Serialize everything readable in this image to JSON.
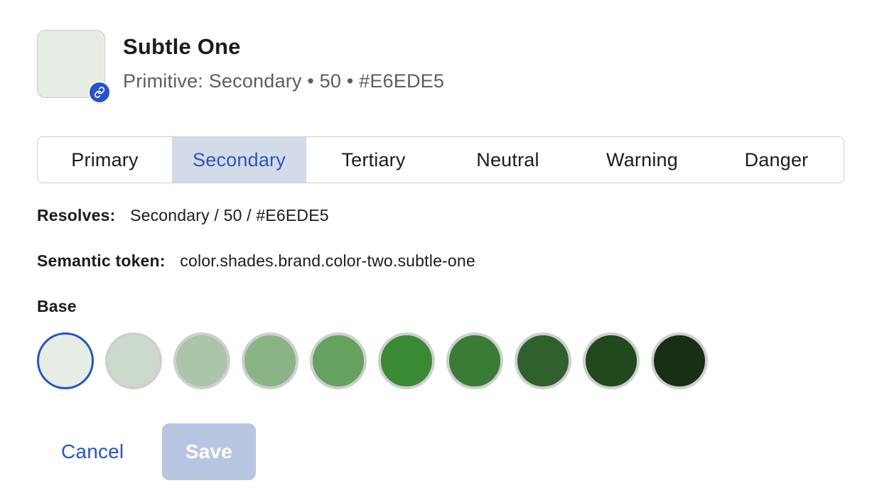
{
  "token": {
    "title": "Subtle One",
    "meta": "Primitive: Secondary • 50 • #E6EDE5",
    "swatch_color": "#E6EDE5",
    "link_icon": "link-icon"
  },
  "tabs": [
    {
      "label": "Primary",
      "active": false
    },
    {
      "label": "Secondary",
      "active": true
    },
    {
      "label": "Tertiary",
      "active": false
    },
    {
      "label": "Neutral",
      "active": false
    },
    {
      "label": "Warning",
      "active": false
    },
    {
      "label": "Danger",
      "active": false
    }
  ],
  "resolves": {
    "label": "Resolves:",
    "value": "Secondary / 50 / #E6EDE5"
  },
  "semantic": {
    "label": "Semantic token:",
    "value": "color.shades.brand.color-two.subtle-one"
  },
  "base": {
    "label": "Base",
    "colors": [
      "#E6EDE5",
      "#CCDACC",
      "#ABC5A8",
      "#8AB486",
      "#66A15F",
      "#3A8A34",
      "#3A7C36",
      "#30612C",
      "#22481E",
      "#172F13"
    ],
    "selected_index": 0
  },
  "actions": {
    "cancel_label": "Cancel",
    "save_label": "Save"
  },
  "colors": {
    "accent": "#2453CF",
    "tab_active_bg": "#D3DBE8",
    "save_disabled_bg": "#B9C6E2"
  }
}
